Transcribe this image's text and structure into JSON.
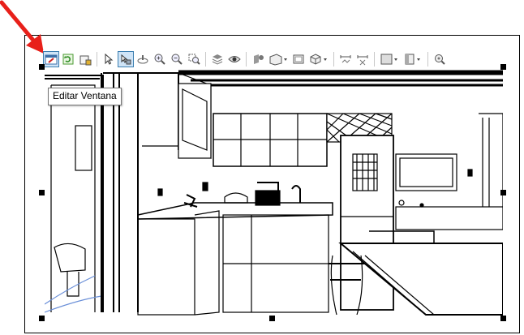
{
  "toolbar": {
    "buttons": [
      {
        "icon": "edit-window-icon",
        "active": true
      },
      {
        "icon": "refresh-icon"
      },
      {
        "icon": "lock-print-icon"
      },
      {
        "icon": "select-arrow-icon"
      },
      {
        "icon": "select-pan-icon",
        "active": true
      },
      {
        "icon": "orbit-icon"
      },
      {
        "icon": "zoom-in-icon"
      },
      {
        "icon": "zoom-out-icon"
      },
      {
        "icon": "zoom-window-icon"
      },
      {
        "icon": "layers-icon"
      },
      {
        "icon": "eye-icon"
      },
      {
        "icon": "render-icon"
      },
      {
        "icon": "box-view-icon",
        "dropdown": true
      },
      {
        "icon": "frame-icon"
      },
      {
        "icon": "cube-icon",
        "dropdown": true
      },
      {
        "icon": "dimension-icon"
      },
      {
        "icon": "dimension-x-icon"
      },
      {
        "icon": "rectangle-icon",
        "dropdown": true
      },
      {
        "icon": "door-icon",
        "dropdown": true
      },
      {
        "icon": "search-settings-icon"
      }
    ]
  },
  "tooltip": {
    "text": "Editar Ventana"
  },
  "colors": {
    "arrow": "#e8201a",
    "active_border": "#3c7fb1",
    "active_fill": "#cfe4f7"
  }
}
